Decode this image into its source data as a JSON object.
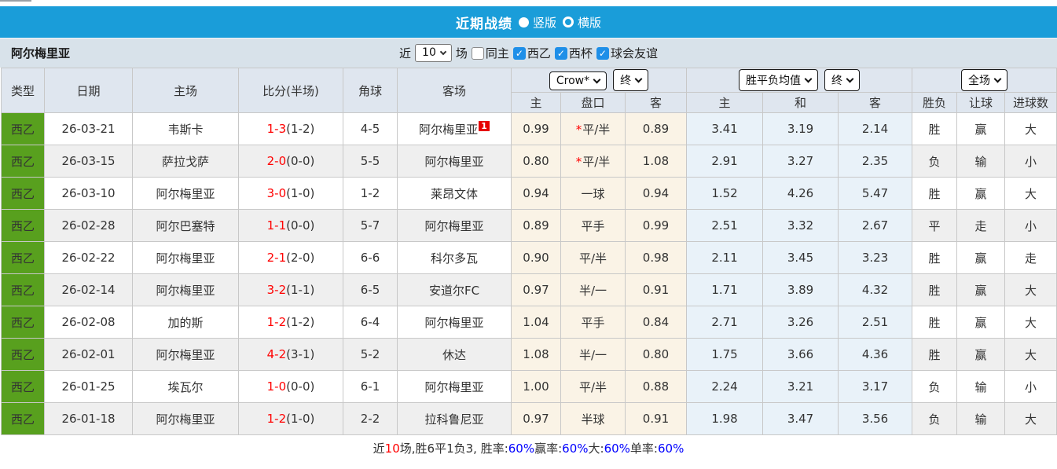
{
  "topbar": {
    "title": "近期战绩",
    "options": [
      {
        "label": "竖版",
        "selected": true
      },
      {
        "label": "横版",
        "selected": false
      }
    ]
  },
  "filter": {
    "team": "阿尔梅里亚",
    "near": "近",
    "count": "10",
    "games": "场",
    "checkboxes": [
      {
        "label": "同主",
        "checked": false
      },
      {
        "label": "西乙",
        "checked": true
      },
      {
        "label": "西杯",
        "checked": true
      },
      {
        "label": "球会友谊",
        "checked": true
      }
    ]
  },
  "table": {
    "main_headers": [
      "类型",
      "日期",
      "主场",
      "比分(半场)",
      "角球",
      "客场"
    ],
    "asian_group": {
      "bookmaker": "Crow*",
      "time": "终",
      "sub": [
        "主",
        "盘口",
        "客"
      ]
    },
    "europe_group": {
      "name": "胜平负均值",
      "time": "终",
      "sub": [
        "主",
        "和",
        "客"
      ]
    },
    "result_group": {
      "scope": "全场",
      "sub": [
        "胜负",
        "让球",
        "进球数"
      ]
    },
    "rows": [
      {
        "type": "西乙",
        "date": "26-03-21",
        "home": {
          "name": "韦斯卡",
          "hl": false
        },
        "score": "1-3",
        "half": "(1-2)",
        "corner": "4-5",
        "away": {
          "name": "阿尔梅里亚",
          "hl": true,
          "sup": "1"
        },
        "ah_home": "0.99",
        "ah_star": true,
        "ah_line": "平/半",
        "ah_away": "0.89",
        "eu_home": "3.41",
        "eu_draw": "3.19",
        "eu_away": "2.14",
        "res_wdl": {
          "t": "胜",
          "c": "red"
        },
        "res_ah": {
          "t": "赢",
          "c": "red"
        },
        "res_ou": {
          "t": "大",
          "c": "red"
        }
      },
      {
        "type": "西乙",
        "date": "26-03-15",
        "home": {
          "name": "萨拉戈萨",
          "hl": false
        },
        "score": "2-0",
        "half": "(0-0)",
        "corner": "5-5",
        "away": {
          "name": "阿尔梅里亚",
          "hl": true
        },
        "ah_home": "0.80",
        "ah_star": true,
        "ah_line": "平/半",
        "ah_away": "1.08",
        "eu_home": "2.91",
        "eu_draw": "3.27",
        "eu_away": "2.35",
        "res_wdl": {
          "t": "负",
          "c": "green"
        },
        "res_ah": {
          "t": "输",
          "c": "green"
        },
        "res_ou": {
          "t": "小",
          "c": "green"
        }
      },
      {
        "type": "西乙",
        "date": "26-03-10",
        "home": {
          "name": "阿尔梅里亚",
          "hl": true
        },
        "score": "3-0",
        "half": "(1-0)",
        "corner": "1-2",
        "away": {
          "name": "莱昂文体",
          "hl": false
        },
        "ah_home": "0.94",
        "ah_star": false,
        "ah_line": "一球",
        "ah_away": "0.94",
        "eu_home": "1.52",
        "eu_draw": "4.26",
        "eu_away": "5.47",
        "res_wdl": {
          "t": "胜",
          "c": "red"
        },
        "res_ah": {
          "t": "赢",
          "c": "red"
        },
        "res_ou": {
          "t": "大",
          "c": "red"
        }
      },
      {
        "type": "西乙",
        "date": "26-02-28",
        "home": {
          "name": "阿尔巴塞特",
          "hl": false
        },
        "score": "1-1",
        "half": "(0-0)",
        "corner": "5-7",
        "away": {
          "name": "阿尔梅里亚",
          "hl": true
        },
        "ah_home": "0.89",
        "ah_star": false,
        "ah_line": "平手",
        "ah_away": "0.99",
        "eu_home": "2.51",
        "eu_draw": "3.32",
        "eu_away": "2.67",
        "res_wdl": {
          "t": "平",
          "c": "blue"
        },
        "res_ah": {
          "t": "走",
          "c": "blue"
        },
        "res_ou": {
          "t": "小",
          "c": "green"
        }
      },
      {
        "type": "西乙",
        "date": "26-02-22",
        "home": {
          "name": "阿尔梅里亚",
          "hl": true
        },
        "score": "2-1",
        "half": "(2-0)",
        "corner": "6-6",
        "away": {
          "name": "科尔多瓦",
          "hl": false
        },
        "ah_home": "0.90",
        "ah_star": false,
        "ah_line": "平/半",
        "ah_away": "0.98",
        "eu_home": "2.11",
        "eu_draw": "3.45",
        "eu_away": "3.23",
        "res_wdl": {
          "t": "胜",
          "c": "red"
        },
        "res_ah": {
          "t": "赢",
          "c": "red"
        },
        "res_ou": {
          "t": "走",
          "c": "blue"
        }
      },
      {
        "type": "西乙",
        "date": "26-02-14",
        "home": {
          "name": "阿尔梅里亚",
          "hl": true
        },
        "score": "3-2",
        "half": "(1-1)",
        "corner": "6-5",
        "away": {
          "name": "安道尔FC",
          "hl": false
        },
        "ah_home": "0.97",
        "ah_star": false,
        "ah_line": "半/一",
        "ah_away": "0.91",
        "eu_home": "1.71",
        "eu_draw": "3.89",
        "eu_away": "4.32",
        "res_wdl": {
          "t": "胜",
          "c": "red"
        },
        "res_ah": {
          "t": "赢",
          "c": "red"
        },
        "res_ou": {
          "t": "大",
          "c": "red"
        }
      },
      {
        "type": "西乙",
        "date": "26-02-08",
        "home": {
          "name": "加的斯",
          "hl": false
        },
        "score": "1-2",
        "half": "(1-2)",
        "corner": "6-4",
        "away": {
          "name": "阿尔梅里亚",
          "hl": true
        },
        "ah_home": "1.04",
        "ah_star": false,
        "ah_line": "平手",
        "ah_away": "0.84",
        "eu_home": "2.71",
        "eu_draw": "3.26",
        "eu_away": "2.51",
        "res_wdl": {
          "t": "胜",
          "c": "red"
        },
        "res_ah": {
          "t": "赢",
          "c": "red"
        },
        "res_ou": {
          "t": "大",
          "c": "red"
        }
      },
      {
        "type": "西乙",
        "date": "26-02-01",
        "home": {
          "name": "阿尔梅里亚",
          "hl": true
        },
        "score": "4-2",
        "half": "(3-1)",
        "corner": "5-2",
        "away": {
          "name": "休达",
          "hl": false
        },
        "ah_home": "1.08",
        "ah_star": false,
        "ah_line": "半/一",
        "ah_away": "0.80",
        "eu_home": "1.75",
        "eu_draw": "3.66",
        "eu_away": "4.36",
        "res_wdl": {
          "t": "胜",
          "c": "red"
        },
        "res_ah": {
          "t": "赢",
          "c": "red"
        },
        "res_ou": {
          "t": "大",
          "c": "red"
        }
      },
      {
        "type": "西乙",
        "date": "26-01-25",
        "home": {
          "name": "埃瓦尔",
          "hl": false
        },
        "score": "1-0",
        "half": "(0-0)",
        "corner": "6-1",
        "away": {
          "name": "阿尔梅里亚",
          "hl": true
        },
        "ah_home": "1.00",
        "ah_star": false,
        "ah_line": "平/半",
        "ah_away": "0.88",
        "eu_home": "2.24",
        "eu_draw": "3.21",
        "eu_away": "3.17",
        "res_wdl": {
          "t": "负",
          "c": "green"
        },
        "res_ah": {
          "t": "输",
          "c": "green"
        },
        "res_ou": {
          "t": "小",
          "c": "green"
        }
      },
      {
        "type": "西乙",
        "date": "26-01-18",
        "home": {
          "name": "阿尔梅里亚",
          "hl": true
        },
        "score": "1-2",
        "half": "(1-0)",
        "corner": "2-2",
        "away": {
          "name": "拉科鲁尼亚",
          "hl": false
        },
        "ah_home": "0.97",
        "ah_star": false,
        "ah_line": "半球",
        "ah_away": "0.91",
        "eu_home": "1.98",
        "eu_draw": "3.47",
        "eu_away": "3.56",
        "res_wdl": {
          "t": "负",
          "c": "green"
        },
        "res_ah": {
          "t": "输",
          "c": "green"
        },
        "res_ou": {
          "t": "大",
          "c": "red"
        }
      }
    ]
  },
  "footer": {
    "segments": [
      {
        "t": "近",
        "c": "black"
      },
      {
        "t": "10",
        "c": "red"
      },
      {
        "t": "场,胜6平1负3, 胜率:",
        "c": "black"
      },
      {
        "t": "60%",
        "c": "blue"
      },
      {
        "t": " 赢率:",
        "c": "black"
      },
      {
        "t": "60%",
        "c": "blue"
      },
      {
        "t": " 大:",
        "c": "black"
      },
      {
        "t": "60%",
        "c": "blue"
      },
      {
        "t": " 单率:",
        "c": "black"
      },
      {
        "t": "60%",
        "c": "blue"
      }
    ]
  },
  "colors": {
    "titlebar_blue": "#1A9DD9",
    "league_green": "#58A01E",
    "team_highlight_green": "#2E9B2E",
    "score_red": "#FF0000",
    "result_red": "#E23E3E",
    "result_green": "#2F9E44",
    "result_blue": "#3535DD",
    "checkbox_blue": "#1E8FE8",
    "asian_odds_bg": "#FAF3E6",
    "europe_odds_bg": "#E9F2F9"
  }
}
